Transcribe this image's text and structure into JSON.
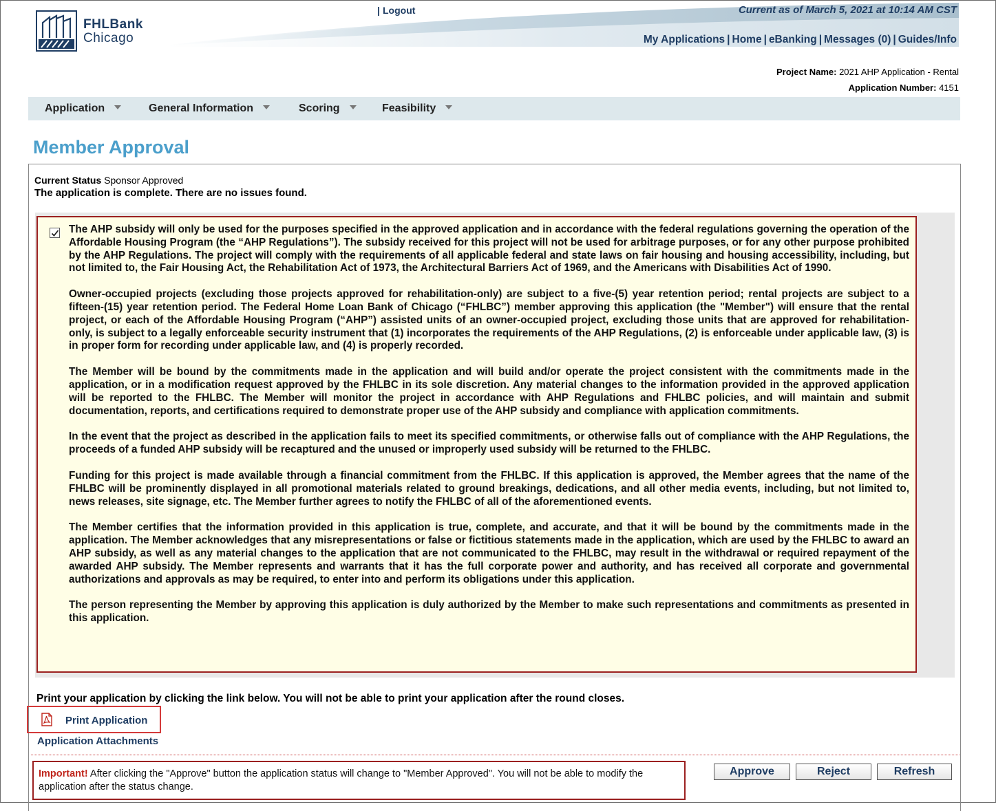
{
  "header": {
    "brand_line1": "FHLBank",
    "brand_line2": "Chicago",
    "logout_separator": "|",
    "logout": "Logout",
    "current_as_of": "Current as of March 5, 2021 at 10:14 AM CST",
    "nav": [
      {
        "label": "My Applications"
      },
      {
        "label": "Home"
      },
      {
        "label": "eBanking"
      },
      {
        "label": "Messages (0)"
      },
      {
        "label": "Guides/Info"
      }
    ],
    "nav_separator": "|"
  },
  "project": {
    "name_label": "Project Name:",
    "name_value": "2021 AHP Application - Rental",
    "number_label": "Application Number:",
    "number_value": "4151"
  },
  "menu": [
    {
      "label": "Application"
    },
    {
      "label": "General Information"
    },
    {
      "label": "Scoring"
    },
    {
      "label": "Feasibility"
    }
  ],
  "page_title": "Member Approval",
  "status": {
    "label": "Current Status",
    "value": "Sponsor Approved",
    "complete_message": "The application is complete. There are no issues found."
  },
  "terms": {
    "checked": true,
    "paragraphs": [
      "The AHP subsidy will only be used for the purposes specified in the approved application and in accordance with the federal regulations governing the operation of the Affordable Housing Program (the “AHP Regulations”). The subsidy received for this project will not be used for arbitrage purposes, or for any other purpose prohibited by the AHP Regulations. The project will comply with the requirements of all applicable federal and state laws on fair housing and housing accessibility, including, but not limited to, the Fair Housing Act, the Rehabilitation Act of 1973, the Architectural Barriers Act of 1969, and the Americans with Disabilities Act of 1990.",
      "Owner-occupied projects (excluding those projects approved for rehabilitation-only) are subject to a five-(5) year retention period; rental projects are subject to a fifteen-(15) year retention period. The Federal Home Loan Bank of Chicago (“FHLBC”) member approving this application (the \"Member\") will ensure that the rental project, or each of the Affordable Housing Program (“AHP”) assisted units of an owner-occupied project, excluding those units that are approved for rehabilitation-only, is subject to a legally enforceable security instrument that (1) incorporates the requirements of the AHP Regulations, (2) is enforceable under applicable law, (3) is in proper form for recording under applicable law, and (4) is properly recorded.",
      "The Member will be bound by the commitments made in the application and will build and/or operate the project consistent with the commitments made in the application, or in a modification request approved by the FHLBC in its sole discretion. Any material changes to the information provided in the approved application will be reported to the FHLBC. The Member will monitor the project in accordance with AHP Regulations and FHLBC policies, and will maintain and submit documentation, reports, and certifications required to demonstrate proper use of the AHP subsidy and compliance with application commitments.",
      "In the event that the project as described in the application fails to meet its specified commitments, or otherwise falls out of compliance with the AHP Regulations, the proceeds of a funded AHP subsidy will be recaptured and the unused or improperly used subsidy will be returned to the FHLBC.",
      "Funding for this project is made available through a financial commitment from the FHLBC. If this application is approved, the Member agrees that the name of the FHLBC will be prominently displayed in all promotional materials related to ground breakings, dedications, and all other media events, including, but not limited to, news releases, site signage, etc. The Member further agrees to notify the FHLBC of all of the aforementioned events.",
      "The Member certifies that the information provided in this application is true, complete, and accurate, and that it will be bound by the commitments made in the application. The Member acknowledges that any misrepresentations or false or fictitious statements made in the application, which are used by the FHLBC to award an AHP subsidy, as well as any material changes to the application that are not communicated to the FHLBC, may result in the withdrawal or required repayment of the awarded AHP subsidy. The Member represents and warrants that it has the full corporate power and authority, and has received all corporate and governmental authorizations and approvals as may be required, to enter into and perform its obligations under this application.",
      "The person representing the Member by approving this application is duly authorized by the Member to make such representations and commitments as presented in this application."
    ]
  },
  "print": {
    "note": "Print your application by clicking the link below. You will not be able to print your application after the round closes.",
    "print_link": "Print Application",
    "attachments_link": "Application Attachments"
  },
  "important": {
    "prefix": "Important!",
    "text": " After clicking the \"Approve\" button the application status will change to \"Member Approved\". You will not be able to modify the application after the status change."
  },
  "buttons": {
    "approve": "Approve",
    "reject": "Reject",
    "refresh": "Refresh"
  },
  "colors": {
    "brand_navy": "#1f3d63",
    "title_blue": "#4b9fcb",
    "menu_bg": "#dde8ec",
    "terms_bg": "#fffee6",
    "border_red": "#9b2020",
    "important_red": "#c0261c"
  }
}
